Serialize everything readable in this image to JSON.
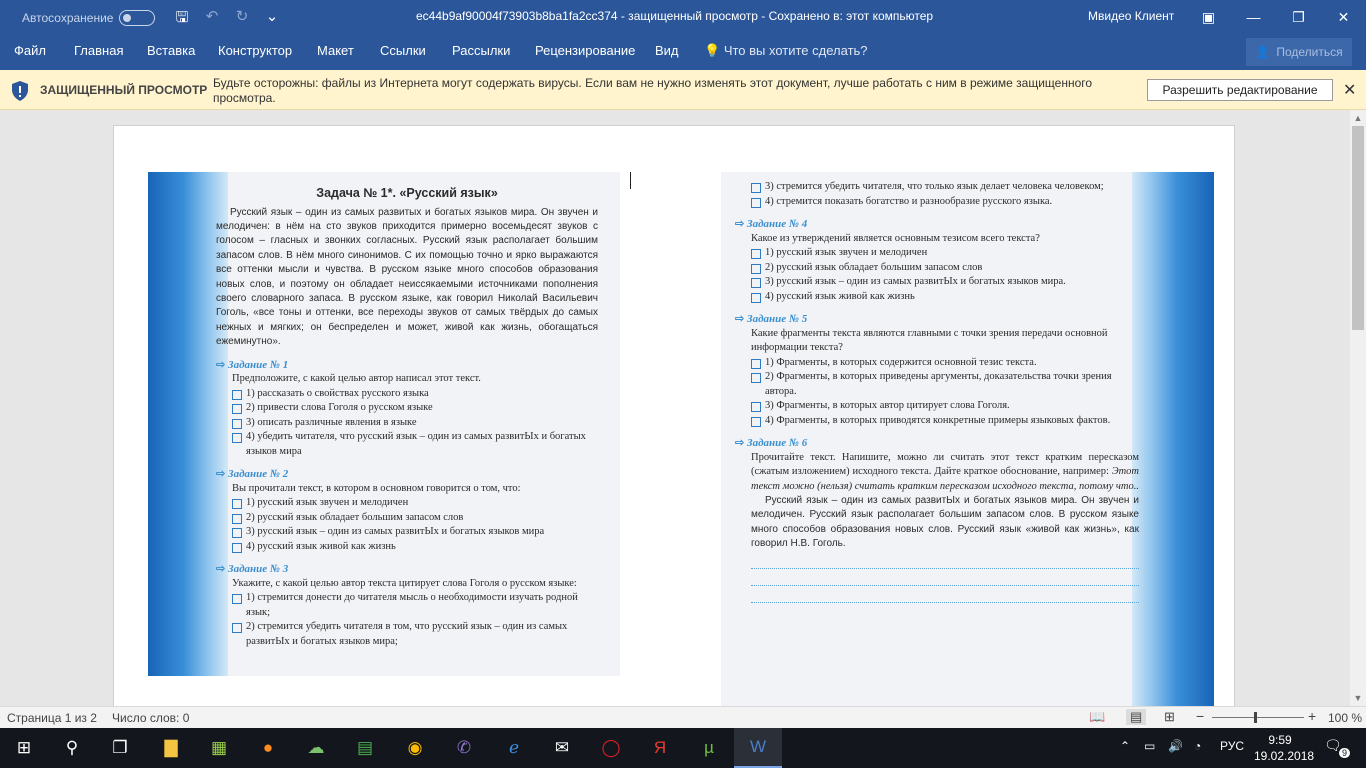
{
  "titlebar": {
    "autosave_label": "Автосохранение",
    "doc_title": "ec44b9af90004f73903b8ba1fa2cc374  -  защищенный просмотр  -  Сохранено в: этот компьютер",
    "user": "Мвидео Клиент"
  },
  "ribbon": {
    "tabs": [
      "Файл",
      "Главная",
      "Вставка",
      "Конструктор",
      "Макет",
      "Ссылки",
      "Рассылки",
      "Рецензирование",
      "Вид"
    ],
    "tell_me": "Что вы хотите сделать?",
    "share": "Поделиться"
  },
  "protected_view": {
    "title": "ЗАЩИЩЕННЫЙ ПРОСМОТР",
    "message": "Будьте осторожны: файлы из Интернета могут содержать вирусы. Если вам не нужно изменять этот документ, лучше работать с ним в режиме защищенного просмотра.",
    "button": "Разрешить редактирование"
  },
  "doc_left": {
    "title": "Задача № 1*. «Русский язык»",
    "passage": "Русский язык – один из самых развитых и богатых языков мира. Он звучен и мелодичен: в нём на сто звуков приходится примерно восемьдесят звуков с голосом – гласных и звонких согласных. Русский язык располагает большим запасом слов. В нём много синонимов. С их помощью точно и ярко выражаются все оттенки мысли и чувства. В русском языке много способов образования новых слов, и поэтому он обладает неиссякаемыми источниками пополнения своего словарного запаса. В русском языке, как говорил Николай Васильевич Гоголь, «все тоны и оттенки, все переходы звуков от самых твёрдых до самых нежных и мягких; он беспределен и может, живой как жизнь, обогащаться ежеминутно».",
    "task1": {
      "label": "Задание № 1",
      "question": "Предположите, с какой целью автор написал этот текст.",
      "options": [
        "1) рассказать о свойствах русского языка",
        "2) привести слова Гоголя о русском языке",
        "3) описать различные явления в языке",
        "4) убедить читателя, что русский язык – один из самых развитЫх и богатых языков мира"
      ]
    },
    "task2": {
      "label": "Задание № 2",
      "question": "Вы прочитали текст, в котором в основном говорится о том, что:",
      "options": [
        "1) русский язык звучен и мелодичен",
        "2) русский язык обладает большим запасом слов",
        "3) русский язык – один из самых развитЫх и богатых языков мира",
        "4) русский язык живой как жизнь"
      ]
    },
    "task3": {
      "label": "Задание № 3",
      "question": "Укажите, с какой целью автор текста цитирует слова Гоголя о русском языке:",
      "options": [
        "1) стремится донести до читателя мысль о необходимости изучать родной язык;",
        "2) стремится убедить читателя в том, что русский язык – один из самых развитЫх и богатых языков мира;"
      ]
    }
  },
  "doc_right": {
    "cont_options": [
      "3) стремится убедить читателя, что только язык делает человека человеком;",
      "4) стремится показать богатство и разнообразие русского языка."
    ],
    "task4": {
      "label": "Задание № 4",
      "question": "Какое из утверждений является основным тезисом всего текста?",
      "options": [
        "1) русский язык звучен и мелодичен",
        "2) русский язык обладает большим запасом слов",
        "3) русский язык – один из самых развитЫх и богатых языков мира.",
        "4) русский язык живой как жизнь"
      ]
    },
    "task5": {
      "label": "Задание № 5",
      "question": "Какие фрагменты текста являются главными с точки зрения передачи основной информации текста?",
      "options": [
        "1) Фрагменты, в которых содержится основной тезис текста.",
        "2) Фрагменты, в которых приведены аргументы, доказательства точки зрения автора.",
        "3) Фрагменты, в которых автор цитирует слова Гоголя.",
        "4) Фрагменты, в которых приводятся конкретные примеры языковых фактов."
      ]
    },
    "task6": {
      "label": "Задание № 6",
      "question": "Прочитайте текст. Напишите, можно ли считать этот текст кратким пересказом (сжатым изложением) исходного текста. Дайте краткое обоснование, например:",
      "example": "Этот текст можно (нельзя) считать кратким пересказом исходного текста, потому что..",
      "passage": "Русский язык – один из самых развитЫх и богатых языков мира. Он звучен и мелодичен. Русский язык располагает большим запасом слов. В русском языке много способов образования новых слов. Русский язык «живой как жизнь», как говорил Н.В. Гоголь."
    }
  },
  "statusbar": {
    "page": "Страница 1 из 2",
    "words": "Число слов: 0",
    "zoom": "100 %"
  },
  "taskbar": {
    "lang": "РУС",
    "time": "9:59",
    "date": "19.02.2018",
    "notifications": "9"
  }
}
